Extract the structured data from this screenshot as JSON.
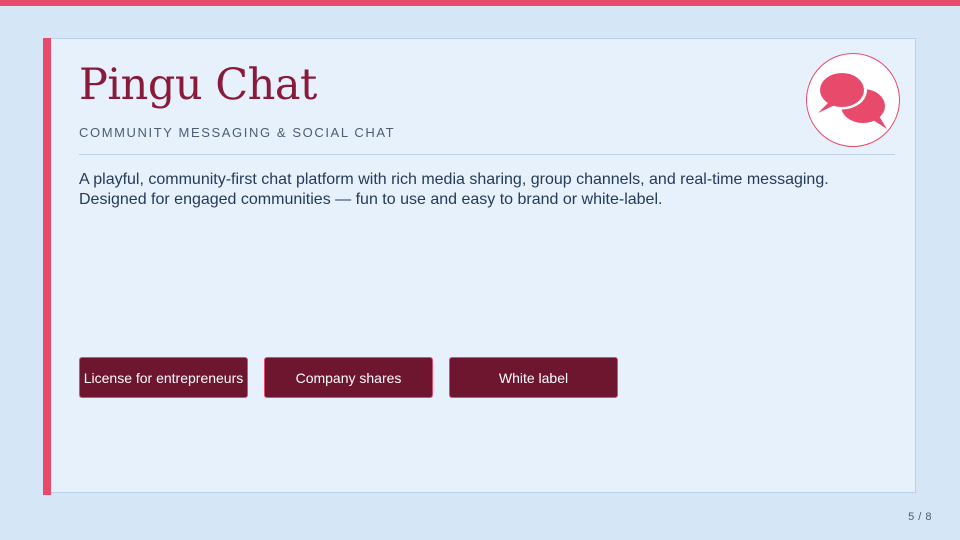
{
  "slide": {
    "title": "Pingu Chat",
    "subtitle": "COMMUNITY MESSAGING & SOCIAL CHAT",
    "description": "A playful, community-first chat platform with rich media sharing, group channels, and real-time messaging. Designed for engaged communities — fun to use and easy to brand or white-label.",
    "logo_icon": "chat-bubbles-icon",
    "buttons": [
      {
        "label": "License for entrepreneurs"
      },
      {
        "label": "Company shares"
      },
      {
        "label": "White label"
      }
    ],
    "page_indicator": "5 / 8"
  },
  "colors": {
    "accent": "#e84a6c",
    "title": "#8a1a3a",
    "button_bg": "#6e1530",
    "background": "#d5e6f6",
    "card_bg": "#e7f1fc"
  }
}
